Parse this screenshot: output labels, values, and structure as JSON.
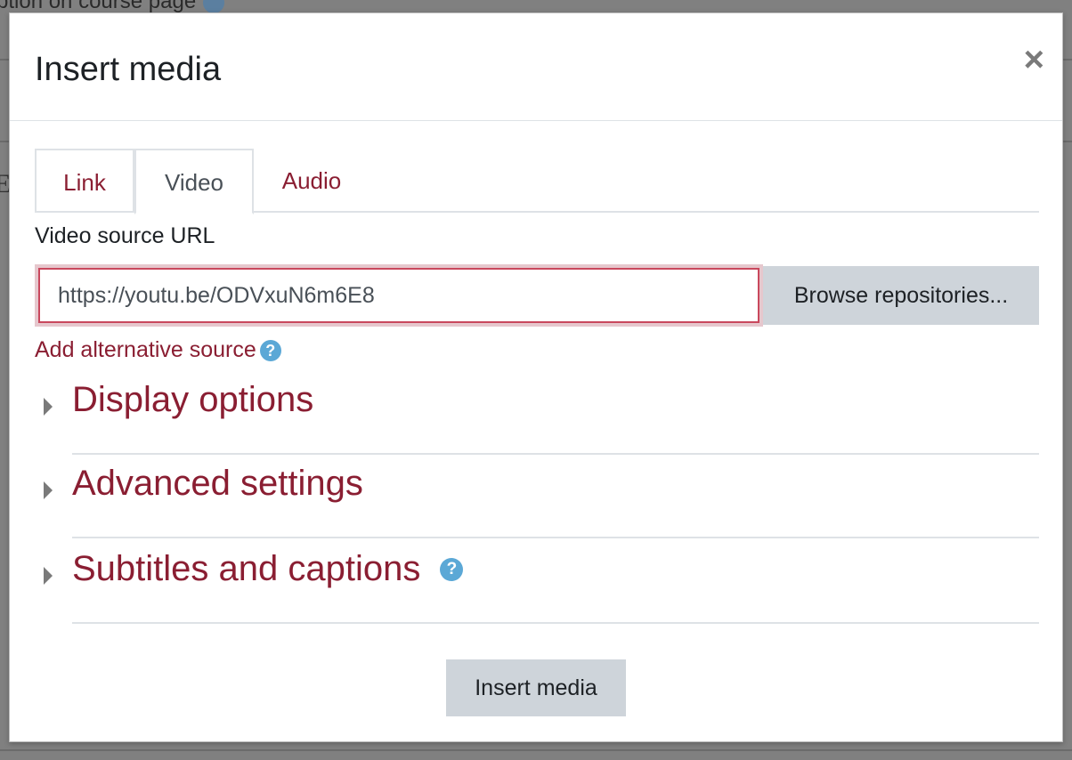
{
  "background": {
    "partial_text": "ption on course page"
  },
  "modal": {
    "title": "Insert media",
    "close_glyph": "×",
    "tabs": [
      {
        "label": "Link"
      },
      {
        "label": "Video",
        "active": true
      },
      {
        "label": "Audio"
      }
    ],
    "video_source": {
      "label": "Video source URL",
      "value": "https://youtu.be/ODVxuN6m6E8",
      "browse_label": "Browse repositories..."
    },
    "add_alternative_label": "Add alternative source",
    "help_glyph": "?",
    "sections": [
      {
        "label": "Display options"
      },
      {
        "label": "Advanced settings"
      },
      {
        "label": "Subtitles and captions"
      }
    ],
    "insert_label": "Insert media"
  },
  "colors": {
    "link": "#8a1e32",
    "button_bg": "#ced4da",
    "input_error_border": "#c9485d",
    "help_icon": "#5ba8d6"
  }
}
